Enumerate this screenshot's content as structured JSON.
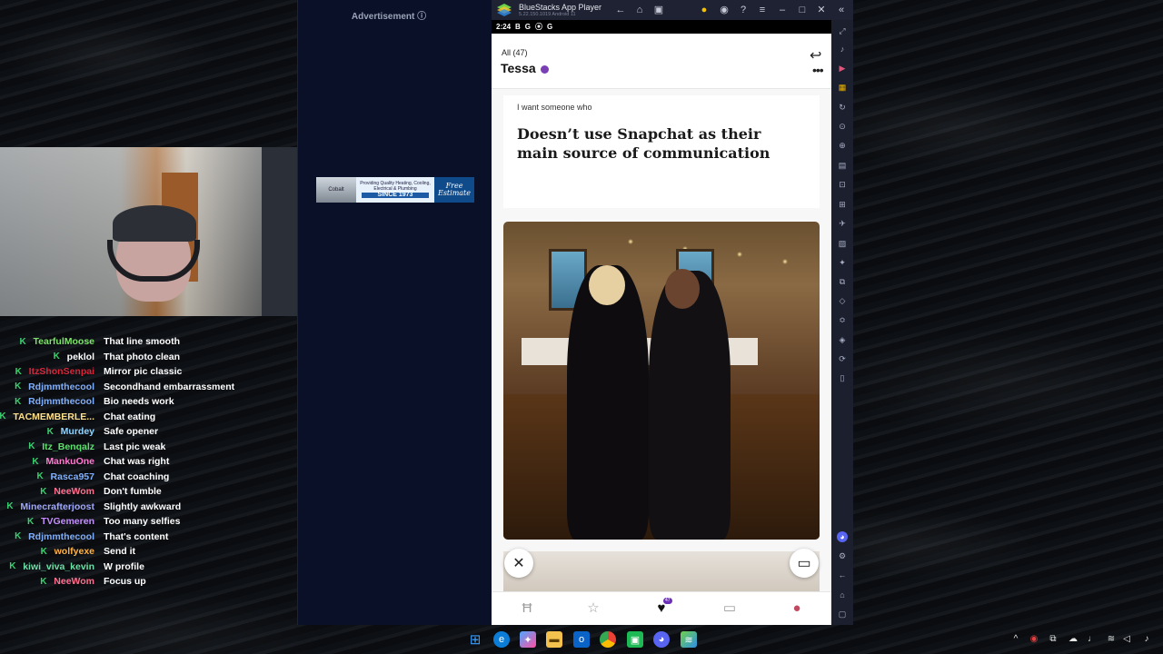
{
  "advert": {
    "label": "Advertisement ⓘ",
    "banner_left": "Cobalt",
    "banner_text": "Providing Quality Heating, Cooling, Electrical & Plumbing",
    "banner_since": "SINCE 1973",
    "banner_right": "Free Estimate"
  },
  "bluestacks": {
    "title": "BlueStacks App Player",
    "version": "5.22.150.1019  Android 11",
    "time": "2:24",
    "status_icons": [
      "B",
      "G",
      "⦿",
      "G"
    ]
  },
  "app": {
    "count_label": "All (47)",
    "profile_name": "Tessa",
    "prompt_question": "I want someone who",
    "prompt_answer": "Doesn’t use Snapchat as their main source of communication",
    "likes_badge": "47"
  },
  "chat": [
    {
      "user": "TearfulMoose",
      "color": "#7ee36a",
      "msg": "That line smooth"
    },
    {
      "user": "peklol",
      "color": "#ffffff",
      "msg": "That photo clean"
    },
    {
      "user": "ItzShonSenpai",
      "color": "#d8263a",
      "msg": "Mirror pic classic"
    },
    {
      "user": "Rdjmmthecool",
      "color": "#7fb0ff",
      "msg": "Secondhand embarrassment"
    },
    {
      "user": "Rdjmmthecool",
      "color": "#7fb0ff",
      "msg": "Bio needs work"
    },
    {
      "user": "TACMEMBERLE...",
      "color": "#ffe08a",
      "msg": "Chat eating"
    },
    {
      "user": "Murdey",
      "color": "#8fd3ff",
      "msg": "Safe opener"
    },
    {
      "user": "Itz_Benqalz",
      "color": "#5ee06e",
      "msg": "Last pic weak"
    },
    {
      "user": "MankuOne",
      "color": "#ff7ad0",
      "msg": "Chat was right"
    },
    {
      "user": "Rasca957",
      "color": "#7fb0ff",
      "msg": "Chat coaching"
    },
    {
      "user": "NeeWom",
      "color": "#ff6f8f",
      "msg": "Don't fumble"
    },
    {
      "user": "Minecrafterjoost",
      "color": "#a0a8ff",
      "msg": "Slightly awkward"
    },
    {
      "user": "TVGemeren",
      "color": "#c58fff",
      "msg": "Too many selfies"
    },
    {
      "user": "Rdjmmthecool",
      "color": "#7fb0ff",
      "msg": "That's content"
    },
    {
      "user": "wolfyexe",
      "color": "#ffb347",
      "msg": "Send it"
    },
    {
      "user": "kiwi_viva_kevin",
      "color": "#6ee0a8",
      "msg": "W profile"
    },
    {
      "user": "NeeWom",
      "color": "#ff6f8f",
      "msg": "Focus up"
    }
  ],
  "colors": {
    "brand_purple": "#6d2fb5",
    "bluestacks_bg": "#1b1f2e",
    "advert_bg": "#0a1028"
  }
}
